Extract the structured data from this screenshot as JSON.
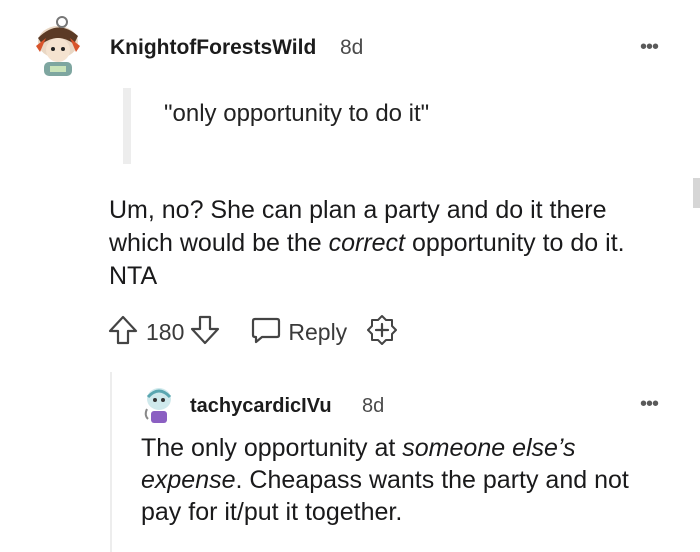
{
  "comment": {
    "username": "KnightofForestsWild",
    "age": "8d",
    "more": "•••",
    "quote": "\"only opportunity to do it\"",
    "body_part1": "Um, no? She can plan a party and do it there which would be the ",
    "body_em": "correct",
    "body_part2": " opportunity to do it. NTA",
    "votes": "180",
    "reply_label": "Reply"
  },
  "reply": {
    "username": "tachycardicIVu",
    "age": "8d",
    "more": "•••",
    "body_part1": "The only opportunity at ",
    "body_em1": "someone else’s expense",
    "body_part2": ". Cheapass wants the party and not pay for it/put it together."
  },
  "icons": {
    "upvote": "arrow-up-icon",
    "downvote": "arrow-down-icon",
    "reply": "speech-bubble-icon",
    "award": "plus-badge-icon",
    "more": "more-dots-icon"
  },
  "colors": {
    "text": "#1a1a1b",
    "muted": "#4a4a4a",
    "quote_bar": "#ededed"
  }
}
